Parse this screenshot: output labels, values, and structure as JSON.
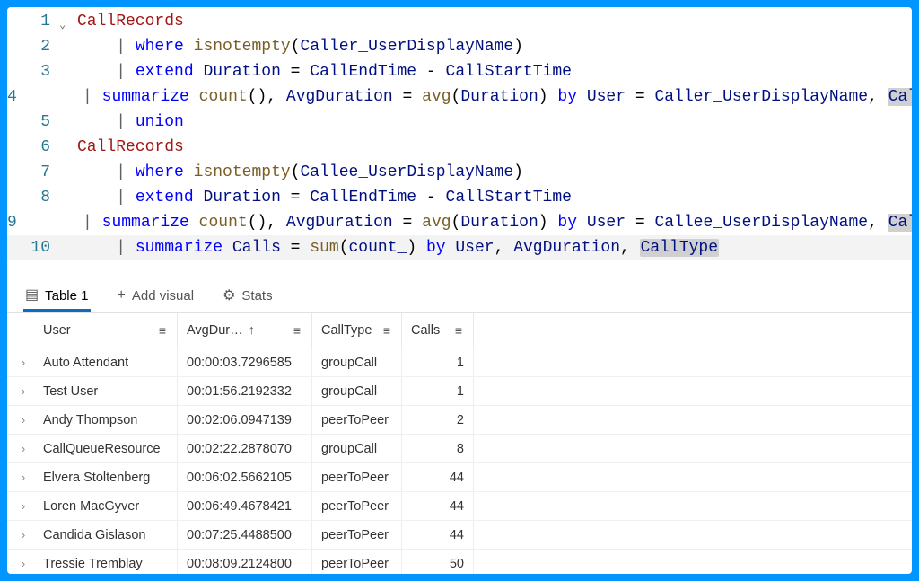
{
  "editor": {
    "lines": [
      {
        "n": "1",
        "tokens": [
          {
            "t": "CallRecords",
            "c": "tok-id"
          }
        ],
        "fold": true,
        "indent": 0
      },
      {
        "n": "2",
        "tokens": [
          {
            "t": "| ",
            "c": "tok-pipe"
          },
          {
            "t": "where",
            "c": "tok-kw"
          },
          {
            "t": " "
          },
          {
            "t": "isnotempty",
            "c": "tok-fn"
          },
          {
            "t": "(",
            "c": "tok-punc"
          },
          {
            "t": "Caller_UserDisplayName",
            "c": "tok-var"
          },
          {
            "t": ")",
            "c": "tok-punc"
          }
        ],
        "indent": 1
      },
      {
        "n": "3",
        "tokens": [
          {
            "t": "| ",
            "c": "tok-pipe"
          },
          {
            "t": "extend",
            "c": "tok-kw"
          },
          {
            "t": " "
          },
          {
            "t": "Duration",
            "c": "tok-var"
          },
          {
            "t": " = ",
            "c": "tok-op"
          },
          {
            "t": "CallEndTime",
            "c": "tok-var"
          },
          {
            "t": " - ",
            "c": "tok-op"
          },
          {
            "t": "CallStartTime",
            "c": "tok-var"
          }
        ],
        "indent": 1
      },
      {
        "n": "4",
        "tokens": [
          {
            "t": "| ",
            "c": "tok-pipe"
          },
          {
            "t": "summarize",
            "c": "tok-kw"
          },
          {
            "t": " "
          },
          {
            "t": "count",
            "c": "tok-fn"
          },
          {
            "t": "()",
            "c": "tok-punc"
          },
          {
            "t": ", "
          },
          {
            "t": "AvgDuration",
            "c": "tok-var"
          },
          {
            "t": " = ",
            "c": "tok-op"
          },
          {
            "t": "avg",
            "c": "tok-fn"
          },
          {
            "t": "(",
            "c": "tok-punc"
          },
          {
            "t": "Duration",
            "c": "tok-var"
          },
          {
            "t": ")",
            "c": "tok-punc"
          },
          {
            "t": " "
          },
          {
            "t": "by",
            "c": "tok-kw"
          },
          {
            "t": " "
          },
          {
            "t": "User",
            "c": "tok-var"
          },
          {
            "t": " = ",
            "c": "tok-op"
          },
          {
            "t": "Caller_UserDisplayName",
            "c": "tok-var"
          },
          {
            "t": ", "
          },
          {
            "t": "CallType",
            "c": "tok-var",
            "hl": true
          }
        ],
        "indent": 1
      },
      {
        "n": "5",
        "tokens": [
          {
            "t": "| ",
            "c": "tok-pipe"
          },
          {
            "t": "union",
            "c": "tok-kw"
          }
        ],
        "indent": 1
      },
      {
        "n": "6",
        "tokens": [
          {
            "t": "CallRecords",
            "c": "tok-id"
          }
        ],
        "indent": 0
      },
      {
        "n": "7",
        "tokens": [
          {
            "t": "| ",
            "c": "tok-pipe"
          },
          {
            "t": "where",
            "c": "tok-kw"
          },
          {
            "t": " "
          },
          {
            "t": "isnotempty",
            "c": "tok-fn"
          },
          {
            "t": "(",
            "c": "tok-punc"
          },
          {
            "t": "Callee_UserDisplayName",
            "c": "tok-var"
          },
          {
            "t": ")",
            "c": "tok-punc"
          }
        ],
        "indent": 1
      },
      {
        "n": "8",
        "tokens": [
          {
            "t": "| ",
            "c": "tok-pipe"
          },
          {
            "t": "extend",
            "c": "tok-kw"
          },
          {
            "t": " "
          },
          {
            "t": "Duration",
            "c": "tok-var"
          },
          {
            "t": " = ",
            "c": "tok-op"
          },
          {
            "t": "CallEndTime",
            "c": "tok-var"
          },
          {
            "t": " - ",
            "c": "tok-op"
          },
          {
            "t": "CallStartTime",
            "c": "tok-var"
          }
        ],
        "indent": 1
      },
      {
        "n": "9",
        "tokens": [
          {
            "t": "| ",
            "c": "tok-pipe"
          },
          {
            "t": "summarize",
            "c": "tok-kw"
          },
          {
            "t": " "
          },
          {
            "t": "count",
            "c": "tok-fn"
          },
          {
            "t": "()",
            "c": "tok-punc"
          },
          {
            "t": ", "
          },
          {
            "t": "AvgDuration",
            "c": "tok-var"
          },
          {
            "t": " = ",
            "c": "tok-op"
          },
          {
            "t": "avg",
            "c": "tok-fn"
          },
          {
            "t": "(",
            "c": "tok-punc"
          },
          {
            "t": "Duration",
            "c": "tok-var"
          },
          {
            "t": ")",
            "c": "tok-punc"
          },
          {
            "t": " "
          },
          {
            "t": "by",
            "c": "tok-kw"
          },
          {
            "t": " "
          },
          {
            "t": "User",
            "c": "tok-var"
          },
          {
            "t": " = ",
            "c": "tok-op"
          },
          {
            "t": "Callee_UserDisplayName",
            "c": "tok-var"
          },
          {
            "t": ", "
          },
          {
            "t": "CallType",
            "c": "tok-var",
            "hl": true
          }
        ],
        "indent": 1
      },
      {
        "n": "10",
        "tokens": [
          {
            "t": "| ",
            "c": "tok-pipe"
          },
          {
            "t": "summarize",
            "c": "tok-kw"
          },
          {
            "t": " "
          },
          {
            "t": "Calls",
            "c": "tok-var"
          },
          {
            "t": " = ",
            "c": "tok-op"
          },
          {
            "t": "sum",
            "c": "tok-fn"
          },
          {
            "t": "(",
            "c": "tok-punc"
          },
          {
            "t": "count_",
            "c": "tok-var"
          },
          {
            "t": ")",
            "c": "tok-punc"
          },
          {
            "t": " "
          },
          {
            "t": "by",
            "c": "tok-kw"
          },
          {
            "t": " "
          },
          {
            "t": "User",
            "c": "tok-var"
          },
          {
            "t": ", "
          },
          {
            "t": "AvgDuration",
            "c": "tok-var"
          },
          {
            "t": ", "
          },
          {
            "t": "CallType",
            "c": "tok-var",
            "hl": true
          }
        ],
        "indent": 1,
        "current": true
      }
    ]
  },
  "tabs": {
    "table": "Table 1",
    "addVisual": "Add visual",
    "stats": "Stats"
  },
  "columns": {
    "user": "User",
    "dur": "AvgDur…",
    "type": "CallType",
    "calls": "Calls"
  },
  "rows": [
    {
      "user": "Auto Attendant",
      "dur": "00:00:03.7296585",
      "type": "groupCall",
      "calls": "1"
    },
    {
      "user": "Test User",
      "dur": "00:01:56.2192332",
      "type": "groupCall",
      "calls": "1"
    },
    {
      "user": "Andy Thompson",
      "dur": "00:02:06.0947139",
      "type": "peerToPeer",
      "calls": "2"
    },
    {
      "user": "CallQueueResource",
      "dur": "00:02:22.2878070",
      "type": "groupCall",
      "calls": "8"
    },
    {
      "user": "Elvera Stoltenberg",
      "dur": "00:06:02.5662105",
      "type": "peerToPeer",
      "calls": "44"
    },
    {
      "user": "Loren MacGyver",
      "dur": "00:06:49.4678421",
      "type": "peerToPeer",
      "calls": "44"
    },
    {
      "user": "Candida Gislason",
      "dur": "00:07:25.4488500",
      "type": "peerToPeer",
      "calls": "44"
    },
    {
      "user": "Tressie Tremblay",
      "dur": "00:08:09.2124800",
      "type": "peerToPeer",
      "calls": "50"
    }
  ]
}
